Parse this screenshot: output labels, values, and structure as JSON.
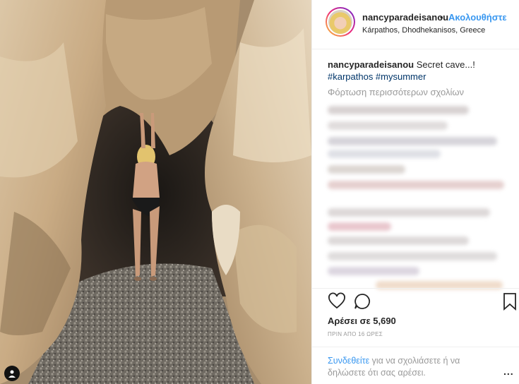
{
  "post": {
    "username": "nancyparadeisanou",
    "separator": "•",
    "follow_label": "Ακολουθήστε",
    "location": "Kárpathos, Dhodhekanisos, Greece",
    "caption_text": "Secret cave...!",
    "hashtags": "#karpathos #mysummer",
    "load_more_comments": "Φόρτωση περισσότερων σχολίων",
    "likes": "Αρέσει σε 5,690",
    "timestamp": "ΠΡΙΝ ΑΠΟ 16 ΩΡΕΣ",
    "login_link": "Συνδεθείτε",
    "login_text": " για να σχολιάσετε ή να δηλώσετε ότι σας αρέσει.",
    "more_options": "..."
  },
  "icons": {
    "like": "heart-icon",
    "comment": "comment-icon",
    "save": "bookmark-icon",
    "tag": "user-tag-icon"
  },
  "colors": {
    "accent": "#3897f0",
    "text": "#262626",
    "muted": "#999999",
    "hashtag": "#003569"
  }
}
